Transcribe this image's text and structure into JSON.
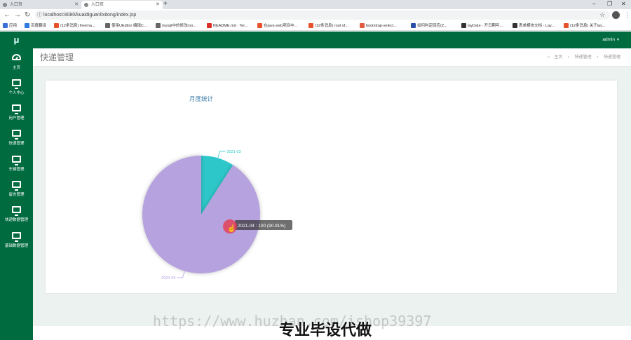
{
  "browser": {
    "tabs": [
      {
        "title": "入口页",
        "active": false
      },
      {
        "title": "入口页",
        "active": true
      }
    ],
    "new_tab": "+",
    "window_controls": [
      "–",
      "❐",
      "✕"
    ],
    "url": "localhost:8080/kuaidiguanlixitong/index.jsp",
    "bookmarks": [
      {
        "label": "应用",
        "color": "#3b6fd8"
      },
      {
        "label": "百度翻译",
        "color": "#2f7be0"
      },
      {
        "label": "(12条消息) freema...",
        "color": "#e5532d"
      },
      {
        "label": "使用UEditor 编辑C...",
        "color": "#666666"
      },
      {
        "label": "mysql中的修改roo...",
        "color": "#666666"
      },
      {
        "label": "README.md · Ter...",
        "color": "#d9302c"
      },
      {
        "label": "在java web项目中...",
        "color": "#e5532d"
      },
      {
        "label": "(12条消息) root of...",
        "color": "#e5532d"
      },
      {
        "label": "bootstrap-select...",
        "color": "#e05d44"
      },
      {
        "label": "如何判定回应(Z...",
        "color": "#2b4fa8"
      },
      {
        "label": "layDate - 开日期年...",
        "color": "#333333"
      },
      {
        "label": "表单横块文档 - Lay...",
        "color": "#333333"
      },
      {
        "label": "(12条消息) 关于lay...",
        "color": "#e5532d"
      }
    ]
  },
  "sidebar": {
    "brand": "μ",
    "items": [
      {
        "label": "主页",
        "icon": "dashboard-icon"
      },
      {
        "label": "个人中心",
        "icon": "monitor-icon"
      },
      {
        "label": "用户管理",
        "icon": "monitor-icon"
      },
      {
        "label": "快递管理",
        "icon": "monitor-icon"
      },
      {
        "label": "车辆管理",
        "icon": "monitor-icon"
      },
      {
        "label": "留言管理",
        "icon": "monitor-icon"
      },
      {
        "label": "快递数据管理",
        "icon": "monitor-icon"
      },
      {
        "label": "基础数据管理",
        "icon": "monitor-icon"
      }
    ]
  },
  "header": {
    "user": "admin",
    "page_title": "快递管理",
    "breadcrumb": [
      "主页",
      "快递管理",
      "快递管理"
    ]
  },
  "chart_data": {
    "type": "pie",
    "title": "月度统计",
    "slices": [
      {
        "label": "2021-03",
        "value": 10,
        "color": "#2ec7c9"
      },
      {
        "label": "2021-04",
        "value": 100,
        "color": "#b6a2de"
      }
    ],
    "tooltip": "2021-04 : 100 (90.91%)"
  },
  "watermark": {
    "url": "https://www.huzhan.com/ishop39397",
    "text": "专业毕设代做"
  }
}
